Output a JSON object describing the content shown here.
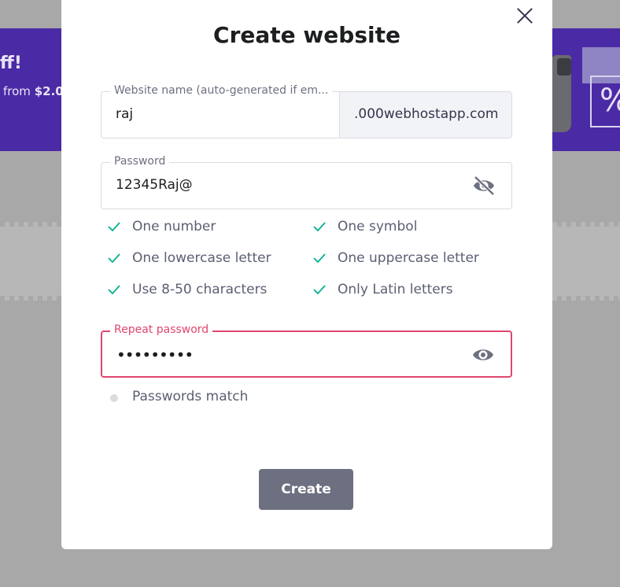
{
  "background": {
    "banner_title": "ff!",
    "banner_sub_prefix": "from",
    "banner_sub_price": "$2.0",
    "percent_glyph": "%"
  },
  "modal": {
    "title": "Create website",
    "website_name": {
      "label": "Website name (auto-generated if em...",
      "value": "raj",
      "suffix": ".000webhostapp.com"
    },
    "password": {
      "label": "Password",
      "value": "12345Raj@",
      "icon": "eye-off-icon"
    },
    "rules": [
      "One number",
      "One symbol",
      "One lowercase letter",
      "One uppercase letter",
      "Use 8-50 characters",
      "Only Latin letters"
    ],
    "repeat_password": {
      "label": "Repeat password",
      "value": "•••••••••",
      "icon": "eye-icon"
    },
    "match_text": "Passwords match",
    "create_label": "Create"
  },
  "colors": {
    "banner": "#4b2aa5",
    "check": "#00b090",
    "error": "#e0466f",
    "button": "#6d7081"
  }
}
